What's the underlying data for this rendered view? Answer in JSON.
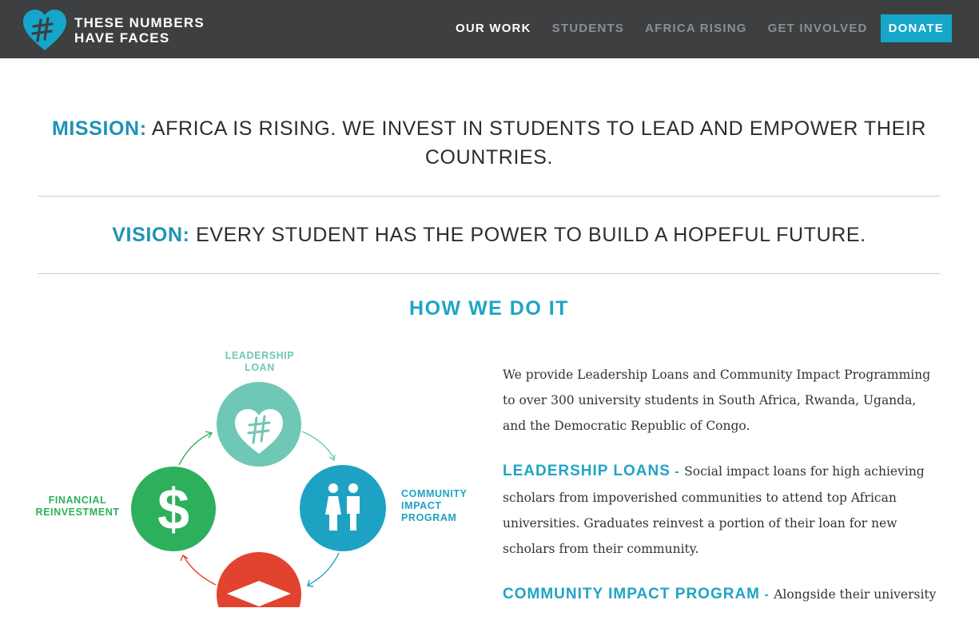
{
  "brand": {
    "line1": "THESE NUMBERS",
    "line2": "HAVE FACES"
  },
  "nav": [
    {
      "label": "OUR WORK"
    },
    {
      "label": "STUDENTS"
    },
    {
      "label": "AFRICA RISING"
    },
    {
      "label": "GET INVOLVED"
    }
  ],
  "donate_label": "DONATE",
  "mission": {
    "lead": "MISSION:",
    "text": "AFRICA IS RISING. WE INVEST IN STUDENTS TO LEAD AND EMPOWER THEIR COUNTRIES."
  },
  "vision": {
    "lead": "VISION:",
    "text": "EVERY STUDENT HAS THE POWER TO BUILD A HOPEFUL FUTURE."
  },
  "how_title": "HOW WE DO IT",
  "diagram": {
    "loan_label": [
      "LEADERSHIP",
      "LOAN"
    ],
    "community_label": [
      "COMMUNITY",
      "IMPACT",
      "PROGRAM"
    ],
    "financial_label": [
      "FINANCIAL",
      "REINVESTMENT"
    ]
  },
  "intro": "We provide Leadership Loans and Community Impact Programming to over 300 university students in South Africa, Rwanda, Uganda, and the Democratic Republic of Congo.",
  "loans": {
    "heading": "LEADERSHIP LOANS",
    "sep": " - ",
    "text": "Social impact loans for high achieving scholars from impoverished communities to attend top African universities. Graduates reinvest a portion of their loan for new scholars from their community."
  },
  "cip": {
    "heading": "COMMUNITY IMPACT PROGRAM",
    "sep": " - ",
    "text": "Alongside their university"
  },
  "colors": {
    "nav_bg": "#3d3f41",
    "accent": "#1fa4c6",
    "loan_green": "#6fc7b5",
    "community_blue": "#1ea2c4",
    "finance_green": "#2db05c",
    "red": "#e2432f"
  }
}
